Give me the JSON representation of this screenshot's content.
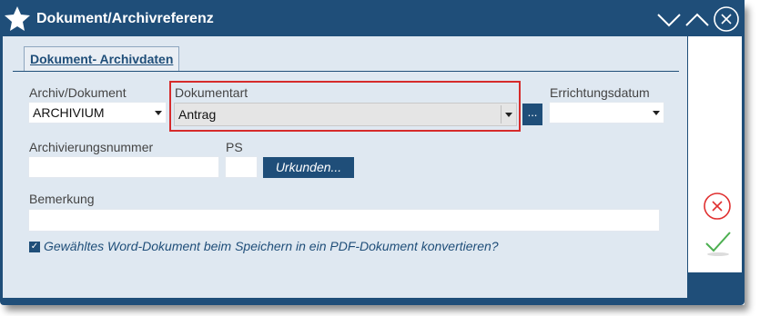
{
  "window": {
    "title": "Dokument/Archivreferenz"
  },
  "tab": {
    "label": "Dokument- Archivdaten"
  },
  "fields": {
    "archiv_label": "Archiv/Dokument",
    "archiv_value": "ARCHIVIUM",
    "dokumentart_label": "Dokumentart",
    "dokumentart_value": "Antrag",
    "browse_label": "...",
    "errichtungsdatum_label": "Errichtungsdatum",
    "errichtungsdatum_value": "",
    "archivierungsnummer_label": "Archivierungsnummer",
    "archivierungsnummer_value": "",
    "ps_label": "PS",
    "ps_value": "",
    "urkunden_label": "Urkunden...",
    "bemerkung_label": "Bemerkung",
    "bemerkung_value": ""
  },
  "option": {
    "checked": true,
    "label": "Gewähltes Word-Dokument beim Speichern in ein PDF-Dokument konvertieren?"
  },
  "colors": {
    "primary": "#1f4e79",
    "background": "#dfe8f1",
    "highlight": "#d62b2b",
    "cancel": "#e03030",
    "confirm": "#4caf50"
  },
  "icons": {
    "app": "star-icon",
    "minimize": "chevron-down-icon",
    "maximize": "chevron-up-icon",
    "close": "close-icon",
    "cancel": "cancel-circle-icon",
    "confirm": "checkmark-icon"
  }
}
